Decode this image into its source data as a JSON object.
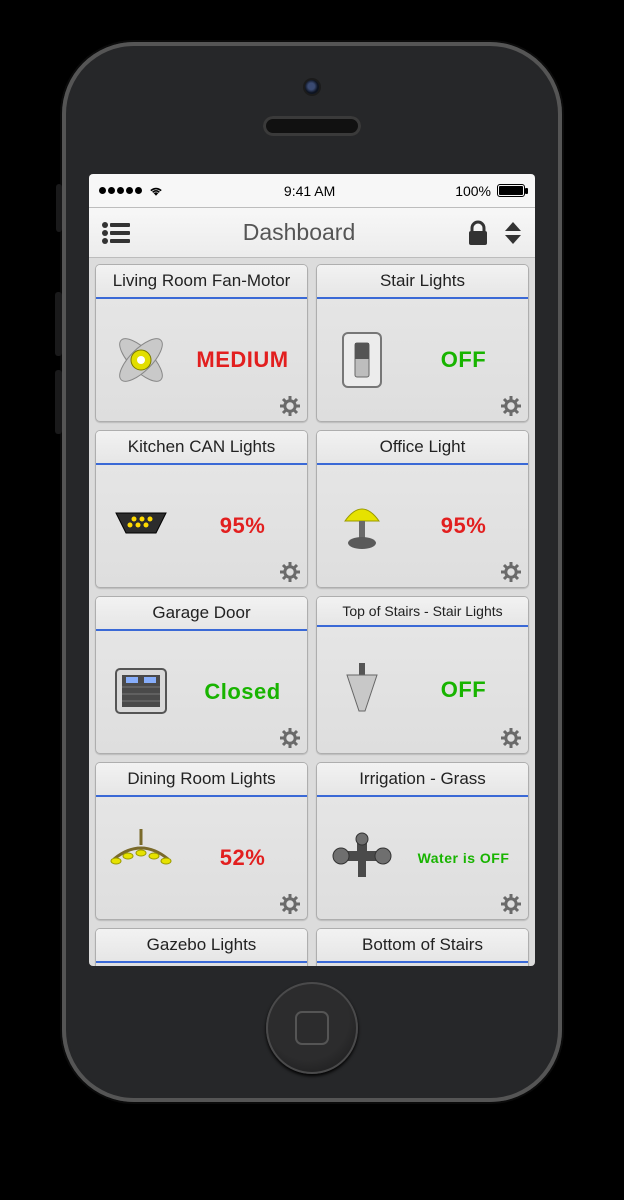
{
  "statusbar": {
    "time": "9:41 AM",
    "battery": "100%"
  },
  "header": {
    "title": "Dashboard"
  },
  "tiles": [
    {
      "title": "Living Room Fan-Motor",
      "value": "MEDIUM",
      "color": "red",
      "icon": "fan"
    },
    {
      "title": "Stair Lights",
      "value": "OFF",
      "color": "green",
      "icon": "switch"
    },
    {
      "title": "Kitchen CAN Lights",
      "value": "95%",
      "color": "red",
      "icon": "canlight"
    },
    {
      "title": "Office Light",
      "value": "95%",
      "color": "red",
      "icon": "lamp"
    },
    {
      "title": "Garage Door",
      "value": "Closed",
      "color": "green",
      "icon": "garage"
    },
    {
      "title": "Top of Stairs - Stair Lights",
      "value": "OFF",
      "color": "green",
      "icon": "sconce",
      "small_title": true
    },
    {
      "title": "Dining Room Lights",
      "value": "52%",
      "color": "red",
      "icon": "chandelier"
    },
    {
      "title": "Irrigation - Grass",
      "value": "Water is OFF",
      "color": "green",
      "icon": "sprinkler",
      "small_value": true
    },
    {
      "title": "Gazebo Lights",
      "cut": true
    },
    {
      "title": "Bottom of Stairs",
      "cut": true
    }
  ]
}
